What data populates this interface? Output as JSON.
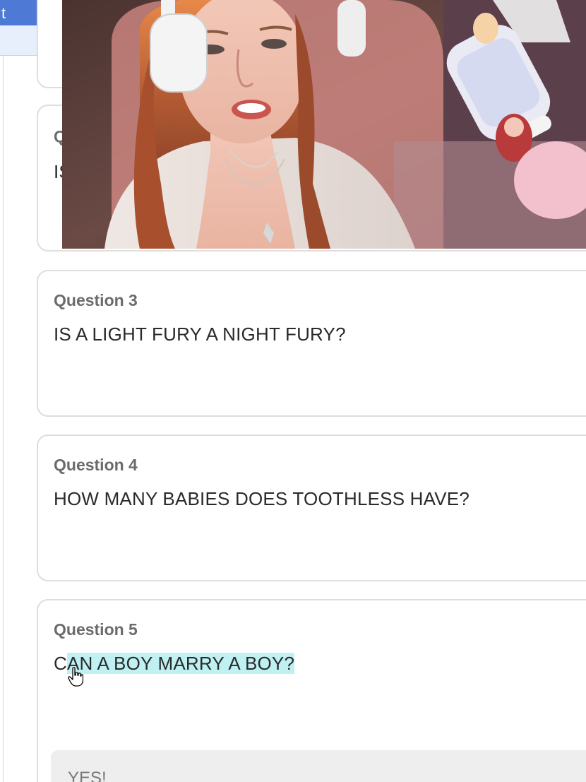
{
  "topbar": {
    "glyph": "t"
  },
  "cards": [
    {
      "label": "Q",
      "text": "IS"
    },
    {
      "label": "Question 3",
      "text": "IS A LIGHT FURY A NIGHT FURY?"
    },
    {
      "label": "Question 4",
      "text": "HOW MANY BABIES DOES TOOTHLESS HAVE?"
    },
    {
      "label": "Question 5",
      "text_lead": "C",
      "text_selected": "AN A BOY MARRY A BOY?",
      "answer": "YES!"
    }
  ],
  "colors": {
    "card_border": "#dedede",
    "label": "#6b6b6b",
    "text": "#2a2a2a",
    "selection": "#bff0f2",
    "answer_bg": "#eeeeee"
  },
  "icons": {
    "cursor": "hand-pointer-icon"
  }
}
